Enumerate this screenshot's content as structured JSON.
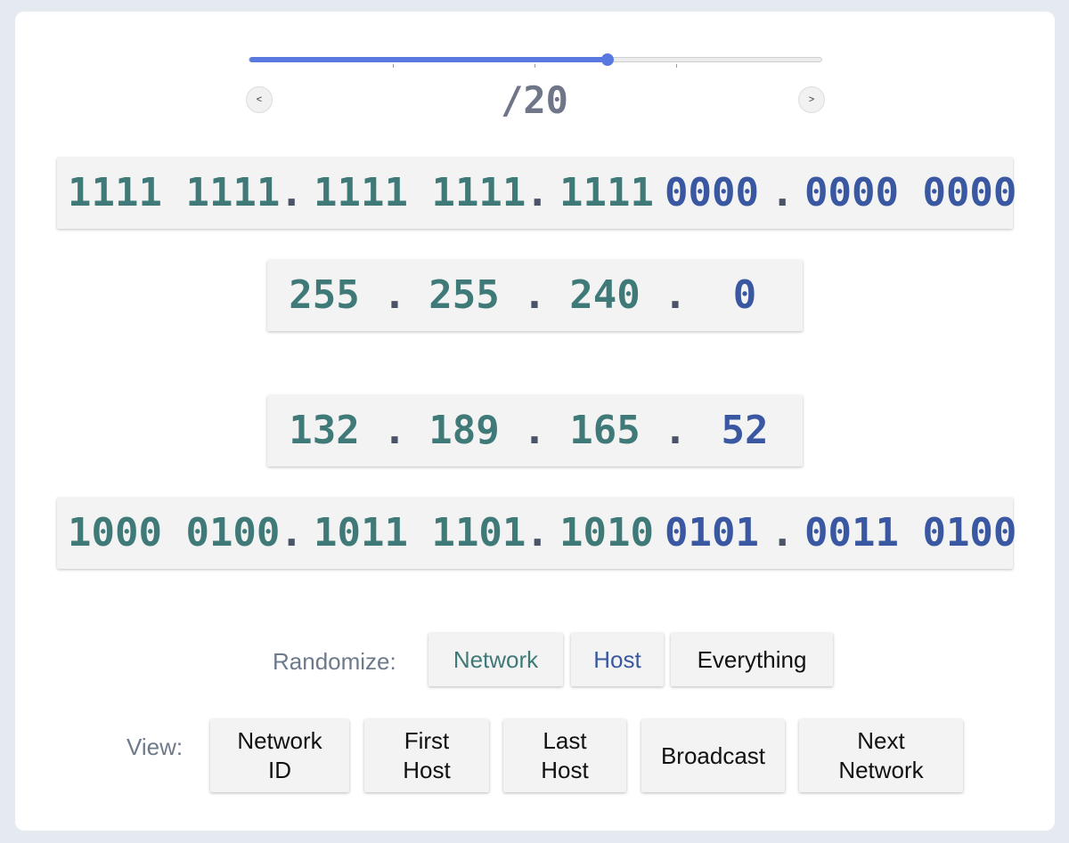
{
  "slider": {
    "prefix_label": "/20",
    "value_fraction": 0.625,
    "prev_label": "<",
    "next_label": ">"
  },
  "mask": {
    "binary": [
      "1111 1111",
      "1111 1111",
      "1111",
      "0000",
      "0000 0000"
    ],
    "decimal": [
      "255",
      "255",
      "240",
      "0"
    ]
  },
  "address": {
    "decimal": [
      "132",
      "189",
      "165",
      "52"
    ],
    "binary": [
      "1000 0100",
      "1011 1101",
      "1010",
      "0101",
      "0011 0100"
    ]
  },
  "separator": ".",
  "randomize": {
    "label": "Randomize:",
    "buttons": [
      "Network",
      "Host",
      "Everything"
    ]
  },
  "view": {
    "label": "View:",
    "buttons": [
      "Network\nID",
      "First\nHost",
      "Last\nHost",
      "Broadcast",
      "Next\nNetwork"
    ]
  },
  "colors": {
    "network": "#3f7a78",
    "host": "#3a58a2",
    "accent": "#5a79e0"
  }
}
